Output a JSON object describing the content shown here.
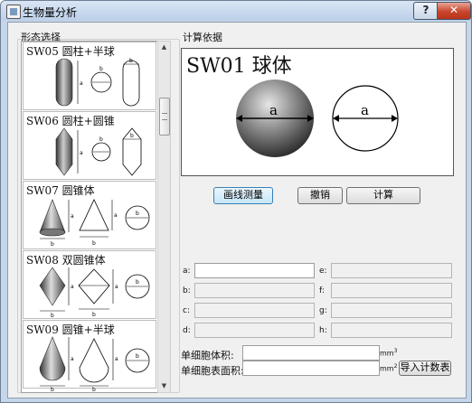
{
  "window": {
    "title": "生物量分析",
    "help_label": "?",
    "close_label": "✕"
  },
  "left_panel": {
    "group_label": "形态选择",
    "items": [
      {
        "label": "SW05 圆柱+半球",
        "dims": [
          "a",
          "b",
          "b"
        ]
      },
      {
        "label": "SW06 圆柱+圆锥",
        "dims": [
          "a",
          "b",
          "b"
        ]
      },
      {
        "label": "SW07 圆锥体",
        "dims": [
          "a",
          "b",
          "a",
          "b",
          "b"
        ]
      },
      {
        "label": "SW08 双圆锥体",
        "dims": [
          "a",
          "b",
          "a",
          "b",
          "b"
        ]
      },
      {
        "label": "SW09 圆锥+半球",
        "dims": [
          "a",
          "b",
          "a",
          "b",
          "b"
        ]
      }
    ]
  },
  "right_panel": {
    "group_label": "计算依据",
    "preview": {
      "title": "SW01 球体",
      "dim_left": "a",
      "dim_right": "a"
    },
    "buttons": {
      "measure": "画线测量",
      "undo": "撤销",
      "compute": "计算"
    },
    "params": {
      "a": "a:",
      "b": "b:",
      "c": "c:",
      "d": "d:",
      "e": "e:",
      "f": "f:",
      "g": "g:",
      "h": "h:"
    },
    "results": {
      "volume_label": "单细胞体积:",
      "volume_unit": "mm",
      "area_label": "单细胞表面积:",
      "area_unit": "mm",
      "volume_exp": "3",
      "area_exp": "2",
      "import_button": "导入计数表"
    }
  }
}
